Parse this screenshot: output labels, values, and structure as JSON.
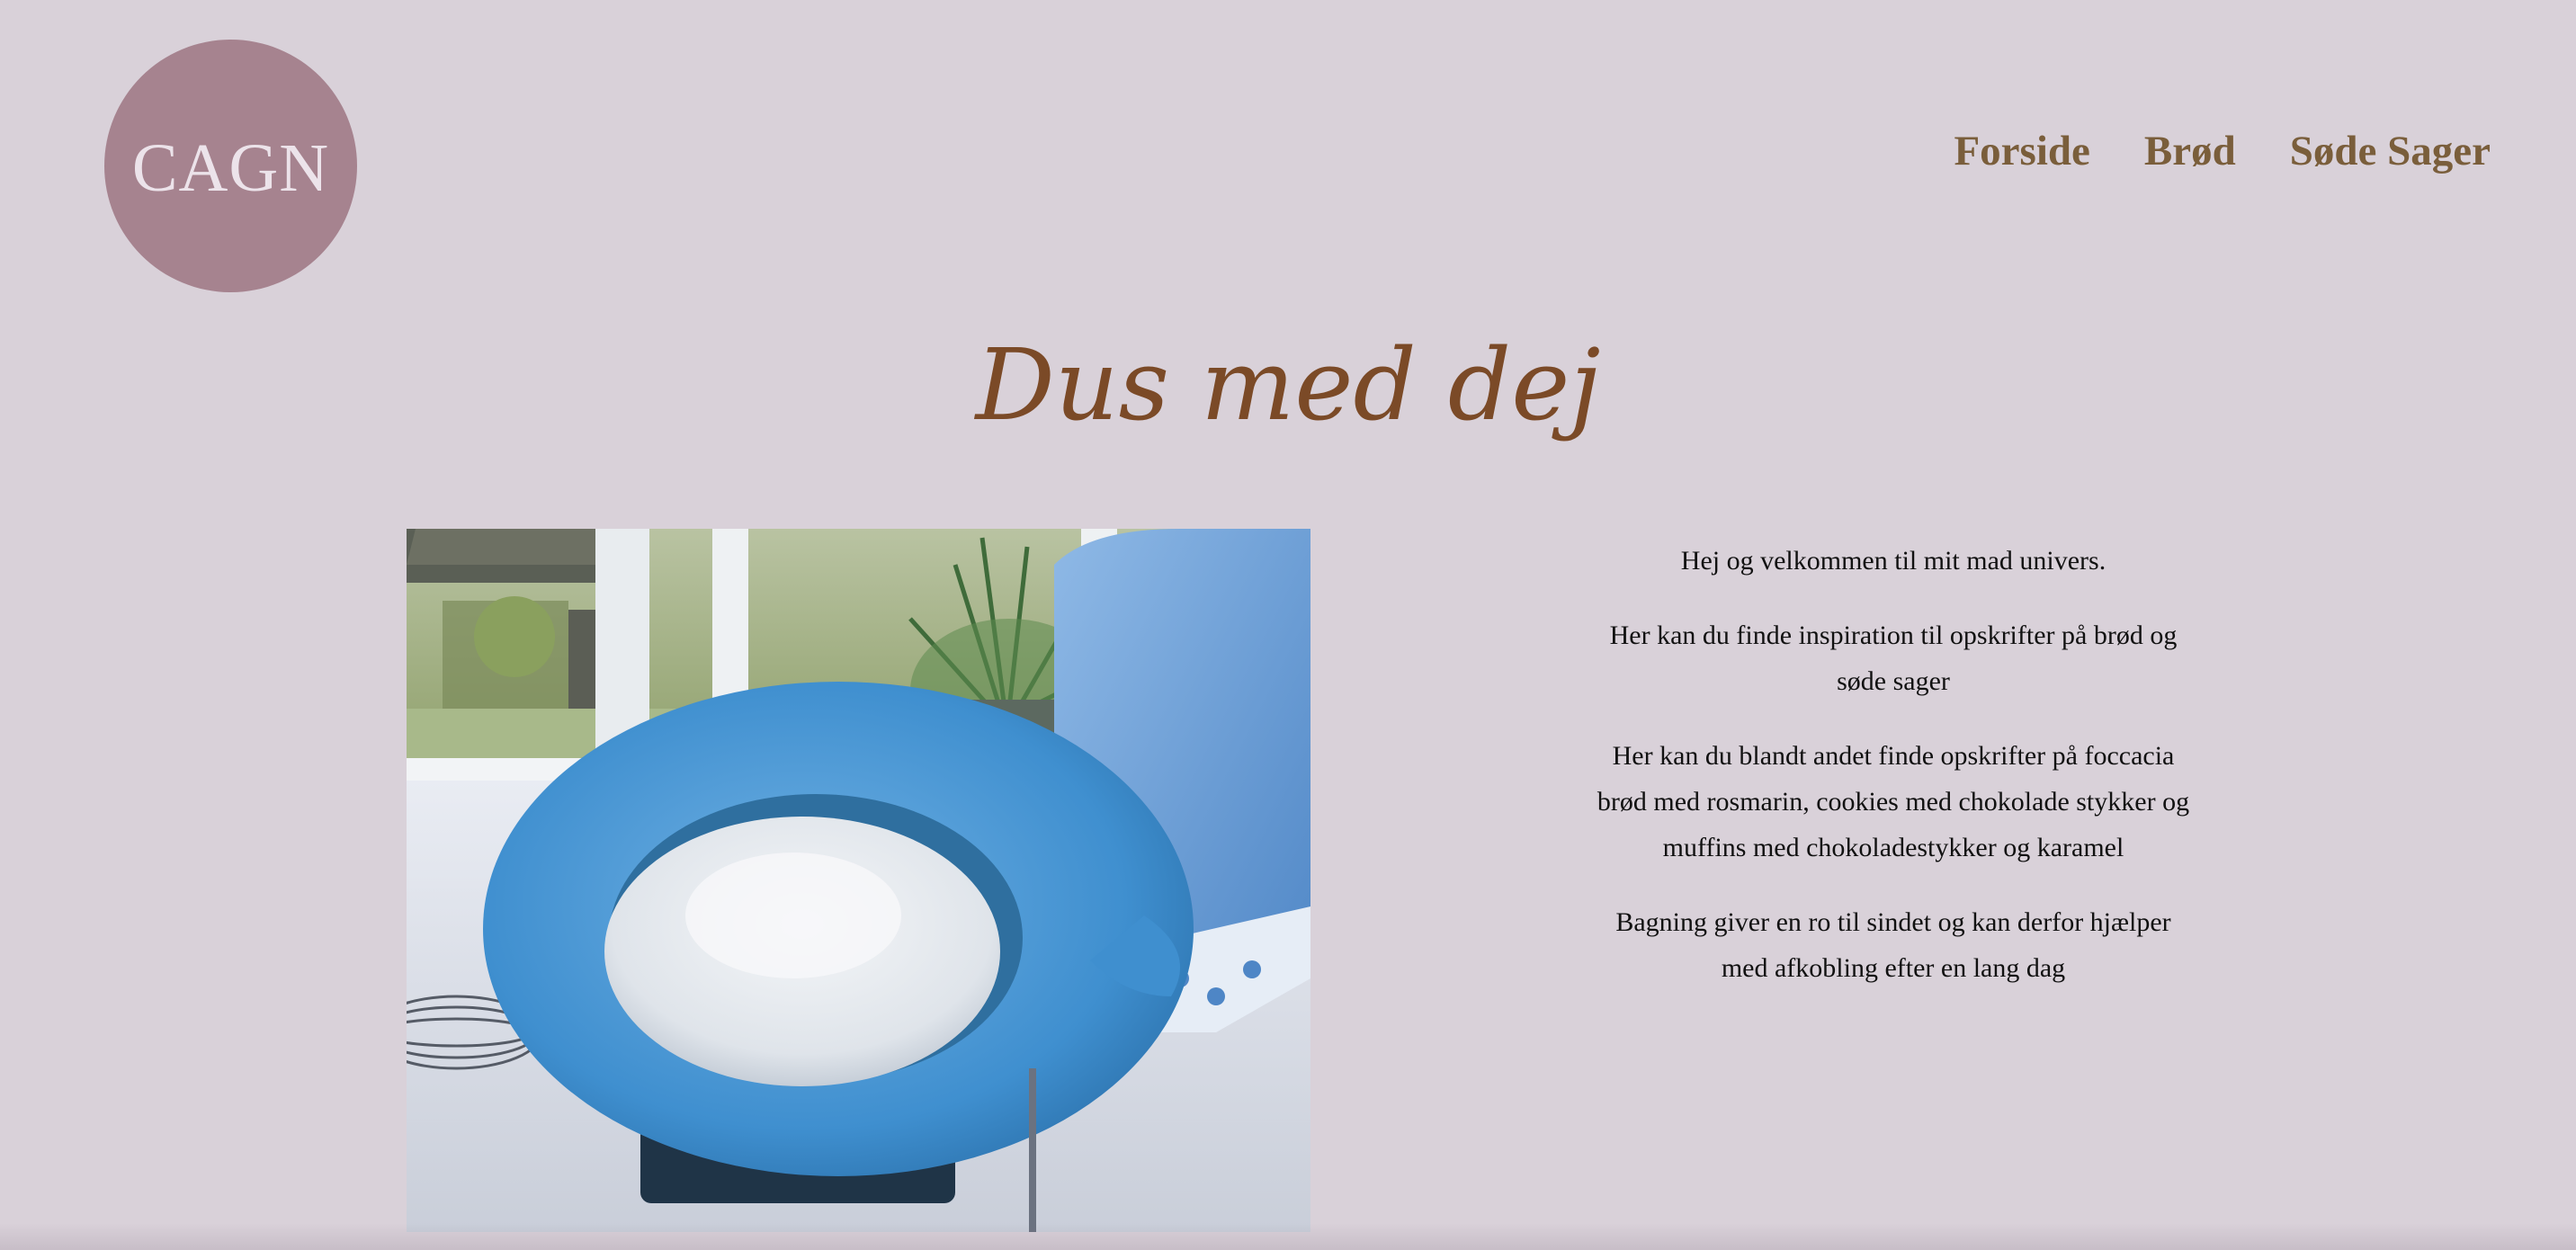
{
  "header": {
    "logo_text": "CAGN",
    "nav": [
      {
        "label": "Forside"
      },
      {
        "label": "Brød"
      },
      {
        "label": "Søde Sager"
      }
    ]
  },
  "main": {
    "title": "Dus med dej",
    "hero_image": {
      "subject": "blue mixing bowl with flour, whisk, flour bag and rosemary plant by a window"
    },
    "intro_paragraphs": [
      "Hej og velkommen til mit mad univers.",
      "Her kan du finde inspiration til opskrifter på brød og søde sager",
      "Her kan du blandt andet finde opskrifter på foccacia brød med rosmarin, cookies med chokolade stykker og muffins med chokoladestykker og karamel",
      "Bagning giver en ro til sindet og kan derfor hjælper med afkobling efter en lang dag"
    ]
  },
  "colors": {
    "background": "#d9d1d9",
    "logo_circle": "#a6838f",
    "nav_text": "#7a5e3b",
    "title_text": "#7b4a27"
  }
}
